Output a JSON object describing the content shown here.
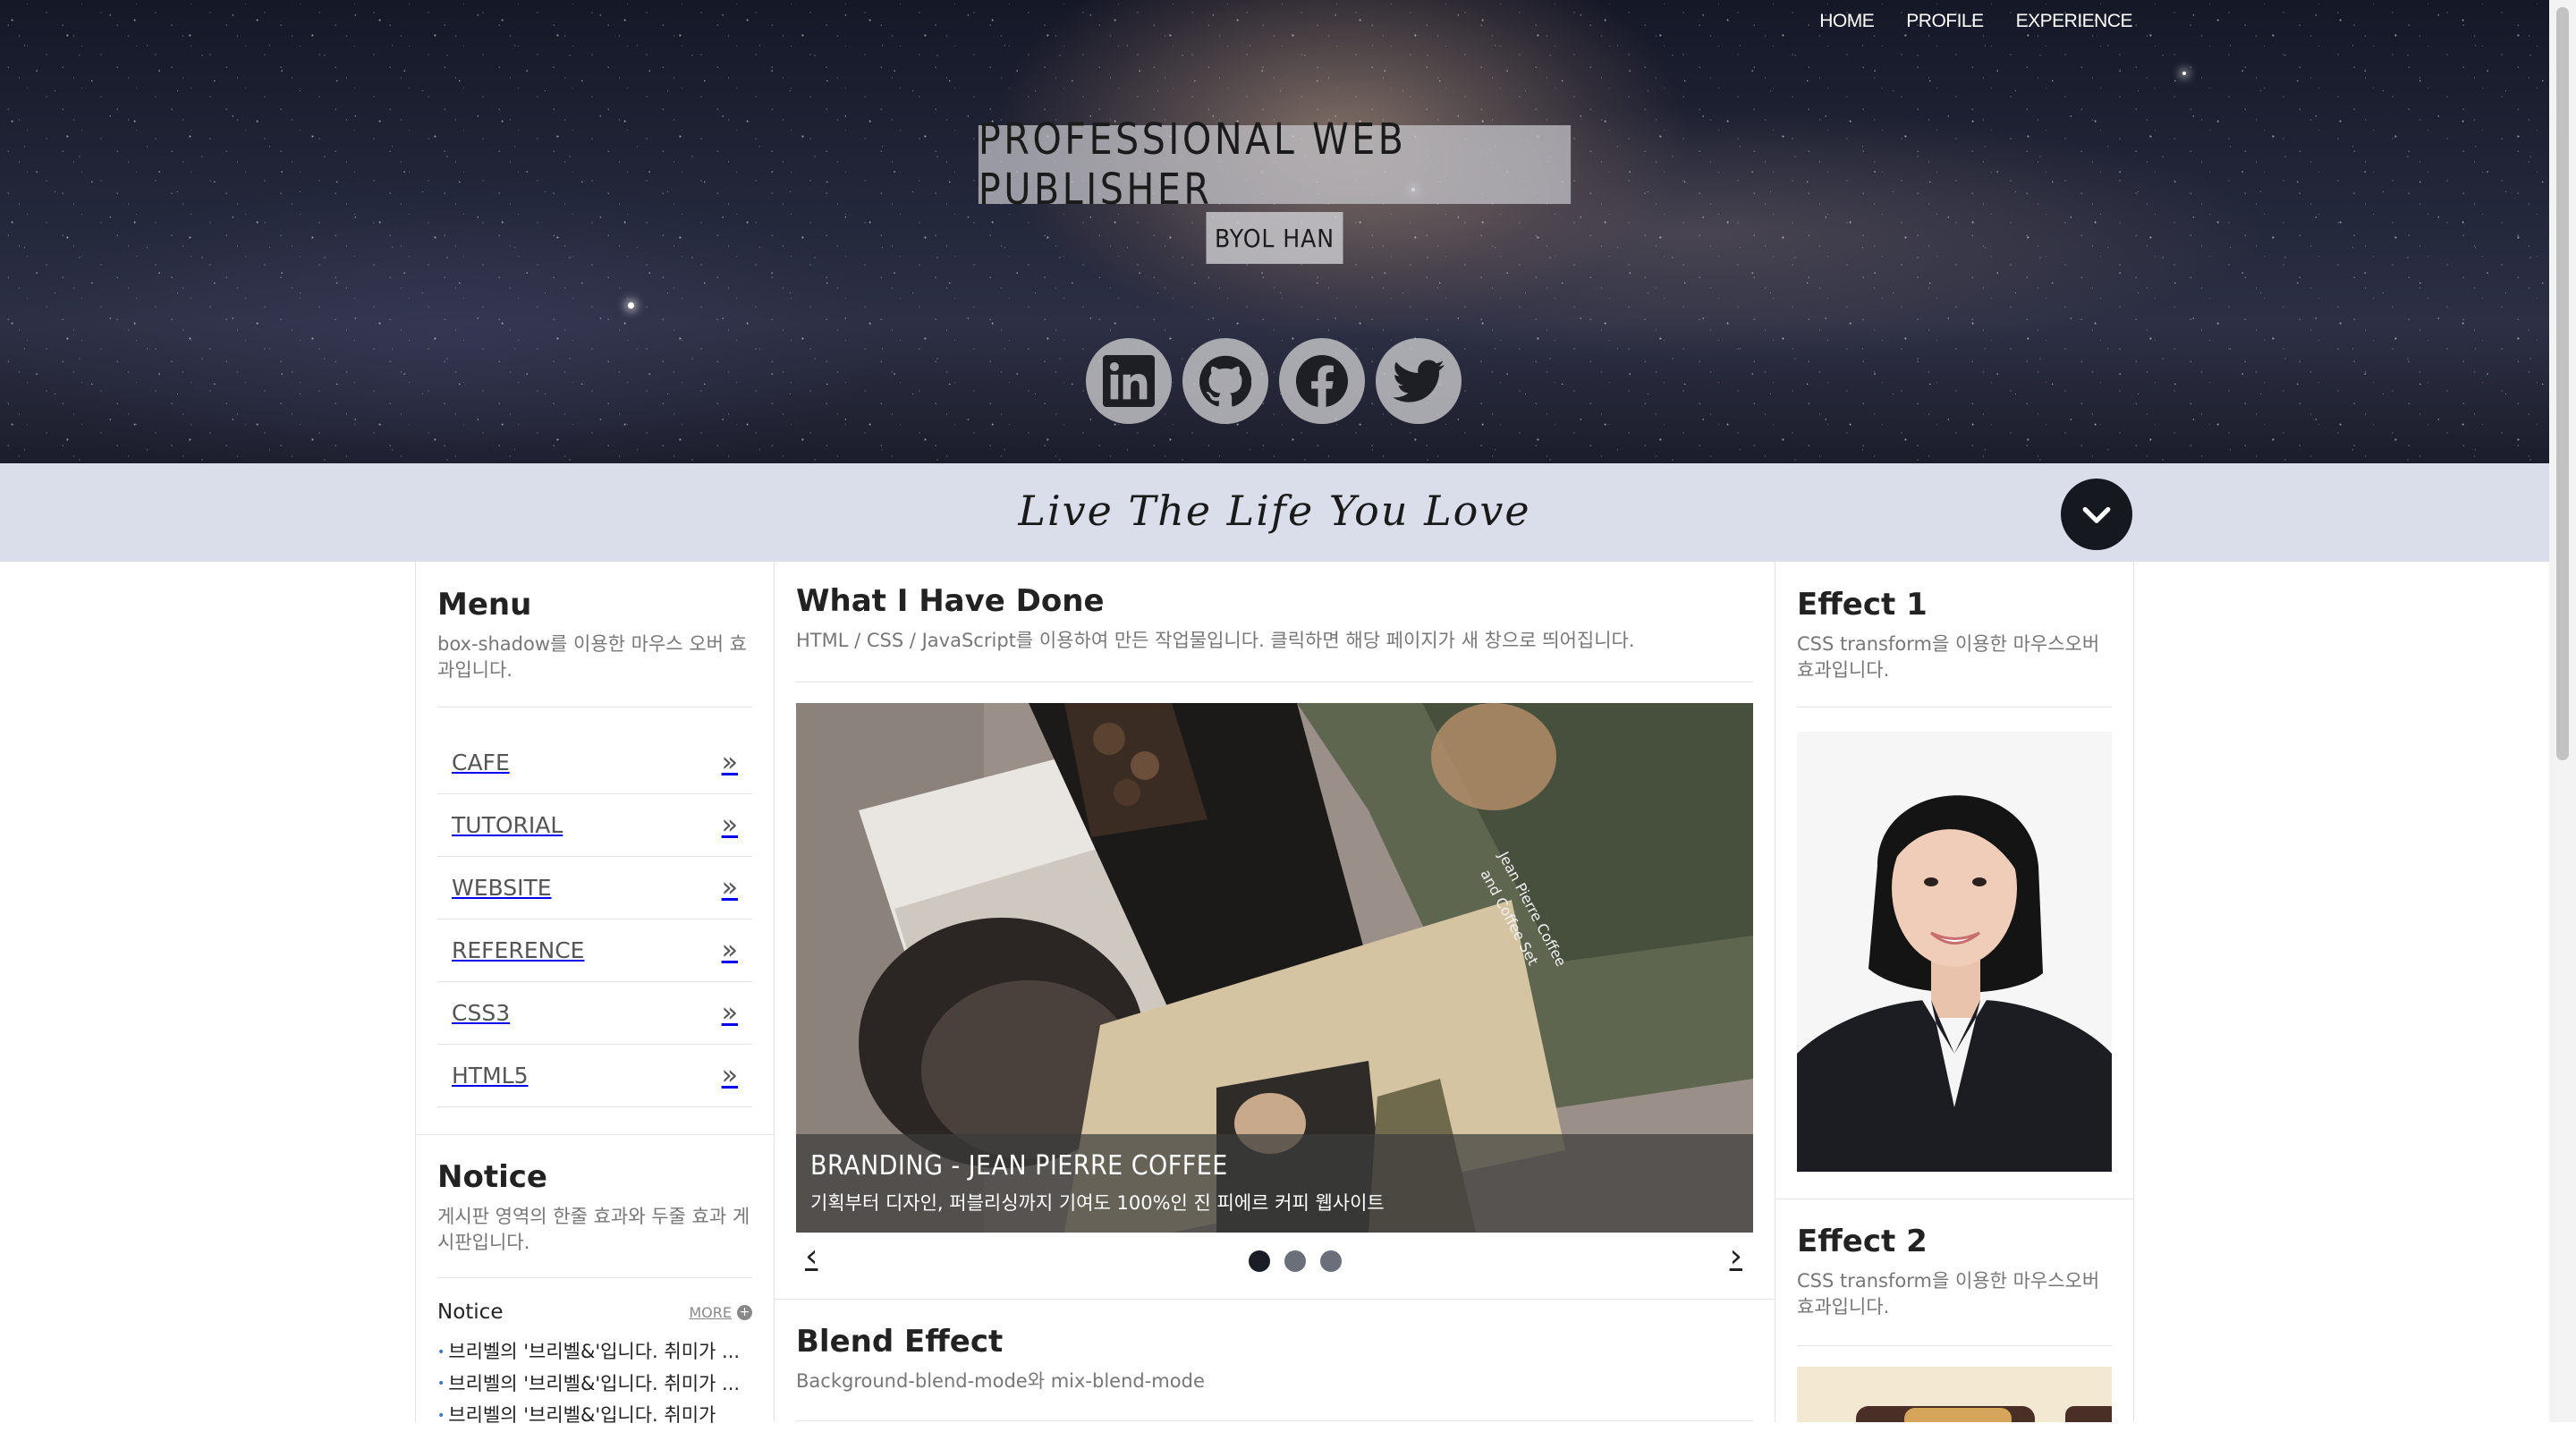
{
  "nav": {
    "items": [
      "HOME",
      "PROFILE",
      "EXPERIENCE"
    ]
  },
  "hero": {
    "title": "PROFESSIONAL WEB PUBLISHER",
    "subtitle": "BYOL HAN",
    "socials": [
      "linkedin-icon",
      "github-icon",
      "facebook-icon",
      "twitter-icon"
    ]
  },
  "banner": {
    "text": "Live The Life You Love"
  },
  "menu": {
    "title": "Menu",
    "desc": "box-shadow를 이용한 마우스 오버 효과입니다.",
    "items": [
      "CAFE",
      "TUTORIAL",
      "WEBSITE",
      "REFERENCE",
      "CSS3",
      "HTML5"
    ]
  },
  "notice": {
    "title": "Notice",
    "desc": "게시판 영역의 한줄 효과와 두줄 효과 게시판입니다.",
    "head": "Notice",
    "more": "MORE",
    "items": [
      "브리벨의 '브리벨&'입니다. 취미가 ...",
      "브리벨의 '브리벨&'입니다. 취미가 ...",
      "브리벨의 '브리벨&'입니다. 취미가"
    ]
  },
  "work": {
    "title": "What I Have Done",
    "desc": "HTML / CSS / JavaScript를 이용하여 만든 작업물입니다. 클릭하면 해당 페이지가 새 창으로 띄어집니다.",
    "slide_title": "BRANDING - JEAN PIERRE COFFEE",
    "slide_desc": "기획부터 디자인, 퍼블리싱까지 기여도 100%인 진 피에르 커피 웹사이트",
    "slide_count": 3,
    "active_slide": 1
  },
  "blend": {
    "title": "Blend Effect",
    "desc": "Background-blend-mode와 mix-blend-mode"
  },
  "effect1": {
    "title": "Effect 1",
    "desc": "CSS transform을 이용한 마우스오버효과입니다."
  },
  "effect2": {
    "title": "Effect 2",
    "desc": "CSS transform을 이용한 마우스오버효과입니다."
  },
  "colors": {
    "banner_bg": "#d9deea",
    "dark": "#15181e",
    "notice_bullet": "#3a76c4"
  }
}
